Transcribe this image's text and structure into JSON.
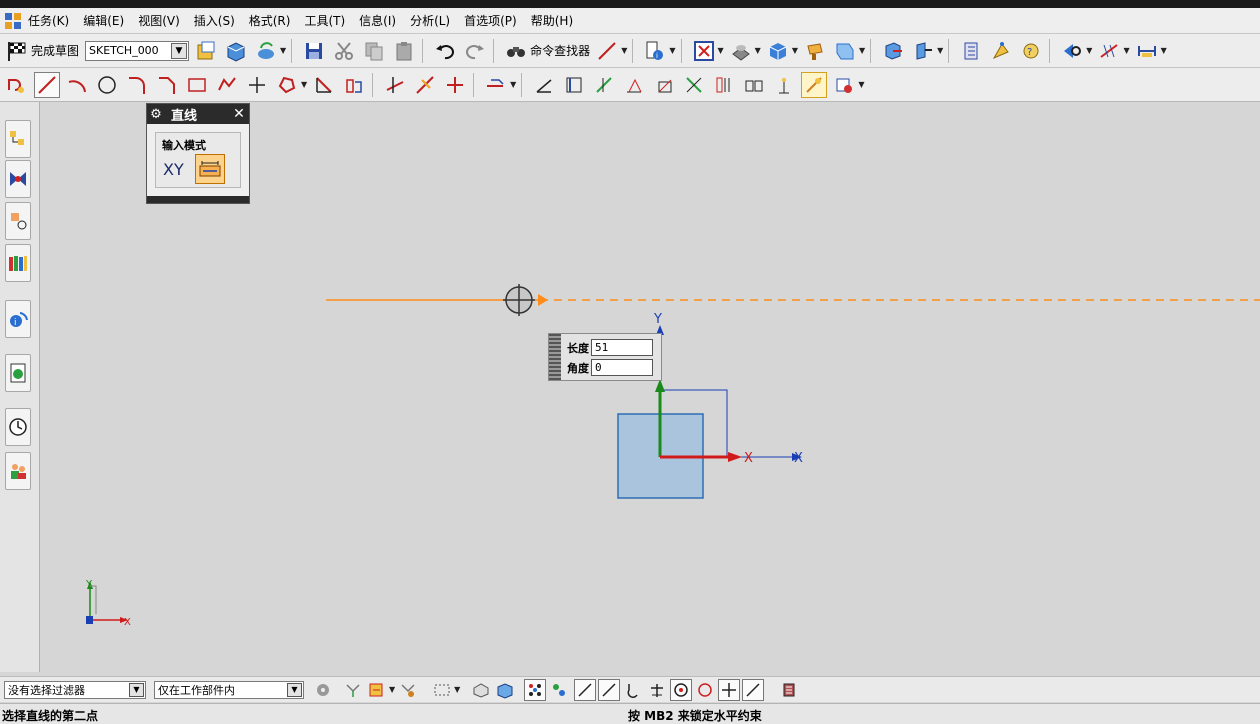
{
  "menu": {
    "items": [
      {
        "label": "任务(K)"
      },
      {
        "label": "编辑(E)"
      },
      {
        "label": "视图(V)"
      },
      {
        "label": "插入(S)"
      },
      {
        "label": "格式(R)"
      },
      {
        "label": "工具(T)"
      },
      {
        "label": "信息(I)"
      },
      {
        "label": "分析(L)"
      },
      {
        "label": "首选项(P)"
      },
      {
        "label": "帮助(H)"
      }
    ]
  },
  "toolbar": {
    "finish_sketch_label": "完成草图",
    "sketch_name": "SKETCH_000",
    "command_finder_label": "命令查找器"
  },
  "line_dialog": {
    "title": "直线",
    "input_mode_label": "输入模式",
    "xy_label": "XY"
  },
  "dynamic_input": {
    "length_label": "长度",
    "length_value": "51",
    "angle_label": "角度",
    "angle_value": "0"
  },
  "canvas": {
    "sketch_y_axis": "Y",
    "sketch_x_axis": "X",
    "sketch_x_axis_2": "X",
    "triad_y": "Y",
    "triad_x": "X",
    "colors": {
      "inference_line": "#ff8c1a",
      "rect_fill": "#a9c4dc",
      "rect_stroke": "#2f6fb5",
      "axis_green": "#1a8a1a",
      "axis_red": "#d11a1a",
      "axis_blue": "#1a3fb5"
    }
  },
  "selection_bar": {
    "filter_value": "没有选择过滤器",
    "scope_value": "仅在工作部件内"
  },
  "status": {
    "prompt": "选择直线的第二点",
    "hint": "按 MB2 来锁定水平约束"
  }
}
